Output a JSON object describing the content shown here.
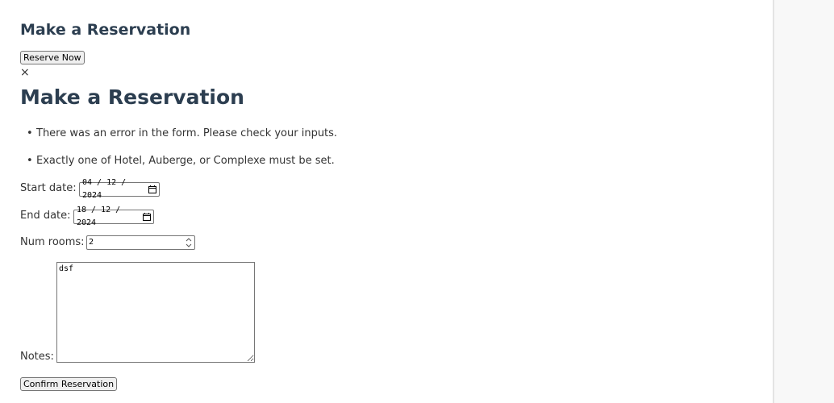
{
  "page": {
    "heading": "Make a Reservation",
    "reserve_button": "Reserve Now"
  },
  "modal": {
    "close_glyph": "×",
    "title": "Make a Reservation",
    "errors": [
      "There was an error in the form. Please check your inputs.",
      "Exactly one of Hotel, Auberge, or Complexe must be set."
    ],
    "form": {
      "start_date_label": "Start date:",
      "start_date_value": "04 / 12 / 2024",
      "end_date_label": "End date:",
      "end_date_value": "18 / 12 / 2024",
      "num_rooms_label": "Num rooms:",
      "num_rooms_value": "2",
      "notes_label": "Notes:",
      "notes_value": "dsf",
      "confirm_button": "Confirm Reservation"
    }
  },
  "icons": {
    "calendar": "calendar-icon",
    "spinner": "number-spinner-icon",
    "close": "close-icon"
  }
}
